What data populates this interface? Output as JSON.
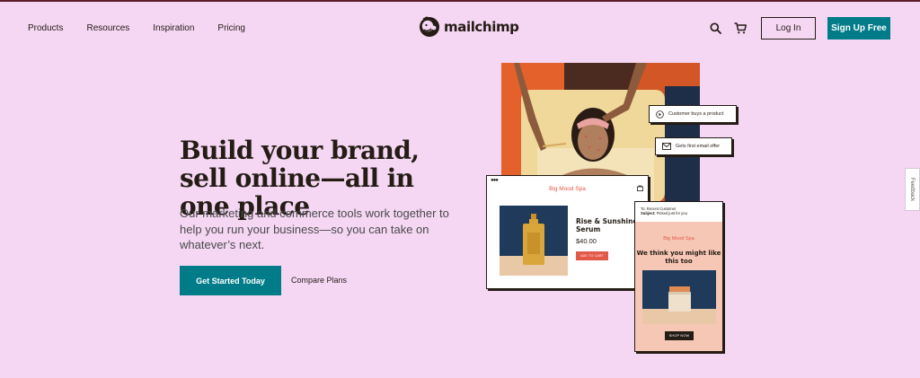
{
  "nav": {
    "links": [
      "Products",
      "Resources",
      "Inspiration",
      "Pricing"
    ],
    "logo_text": "mailchimp",
    "login_label": "Log In",
    "signup_label": "Sign Up Free"
  },
  "hero": {
    "title": "Build your brand, sell online—all in one place",
    "subtitle": "Our marketing and commerce tools work together to help you run your business—so you can take on whatever’s next.",
    "cta_primary": "Get Started Today",
    "cta_secondary": "Compare Plans"
  },
  "collage": {
    "bubble_1": "Customer buys a product",
    "bubble_2": "Gets first email offer",
    "store_card": {
      "store_name": "Big Mood Spa",
      "product_title": "Rise & Sunshine Serum",
      "price": "$40.00",
      "add_to_cart": "ADD TO CART"
    },
    "email_card": {
      "to_line": "To: Recent Customer",
      "subject_label": "Subject:",
      "subject_value": "Picked just for you",
      "store_name": "Big Mood Spa",
      "headline": "We think you might like this too",
      "shop_now": "SHOP NOW"
    }
  },
  "feedback_label": "Feedback",
  "colors": {
    "background": "#f5d7f4",
    "accent_teal": "#007c89",
    "text_dark": "#241c15",
    "coral": "#e2594a"
  },
  "icons": [
    "mailchimp-logo-icon",
    "search-icon",
    "cart-icon",
    "play-icon",
    "mail-icon",
    "shopping-bag-icon"
  ]
}
